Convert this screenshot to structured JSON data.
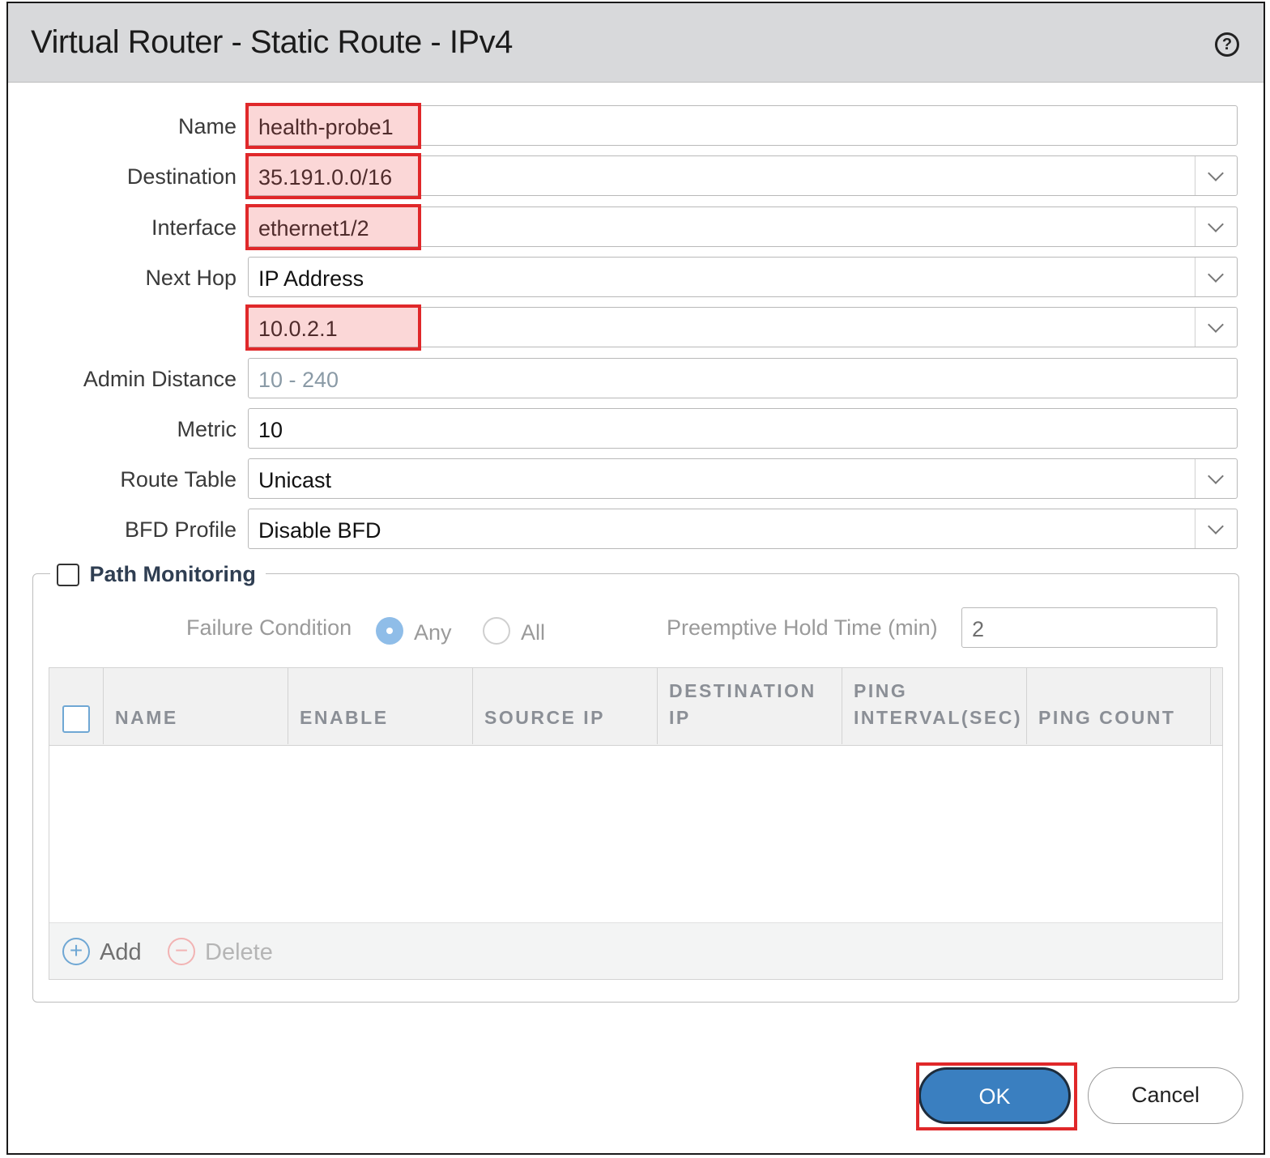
{
  "dialog": {
    "title": "Virtual Router - Static Route - IPv4",
    "help_icon": "?"
  },
  "form": {
    "name": {
      "label": "Name",
      "value": "health-probe1"
    },
    "destination": {
      "label": "Destination",
      "value": "35.191.0.0/16"
    },
    "interface": {
      "label": "Interface",
      "value": "ethernet1/2"
    },
    "next_hop": {
      "label": "Next Hop",
      "value": "IP Address"
    },
    "next_hop_address": {
      "value": "10.0.2.1"
    },
    "admin_distance": {
      "label": "Admin Distance",
      "placeholder": "10 - 240"
    },
    "metric": {
      "label": "Metric",
      "value": "10"
    },
    "route_table": {
      "label": "Route Table",
      "value": "Unicast"
    },
    "bfd_profile": {
      "label": "BFD Profile",
      "value": "Disable BFD"
    }
  },
  "path_monitoring": {
    "label": "Path Monitoring",
    "checked": false,
    "failure_condition": {
      "label": "Failure Condition",
      "options": [
        "Any",
        "All"
      ],
      "selected": "Any"
    },
    "preemptive_hold_time": {
      "label": "Preemptive Hold Time (min)",
      "value": "2"
    },
    "table": {
      "columns": [
        "NAME",
        "ENABLE",
        "SOURCE IP",
        "DESTINATION IP",
        "PING INTERVAL(SEC)",
        "PING COUNT"
      ],
      "rows": []
    },
    "actions": {
      "add": "Add",
      "delete": "Delete"
    }
  },
  "buttons": {
    "ok": "OK",
    "cancel": "Cancel"
  },
  "colors": {
    "highlight": "#e0282a",
    "ok_button": "#3a7fc0",
    "title_bar": "#d8d9db",
    "label": "#3a3a3a"
  },
  "icons": [
    "help-icon",
    "chevron-down-icon",
    "add-icon",
    "delete-icon"
  ]
}
